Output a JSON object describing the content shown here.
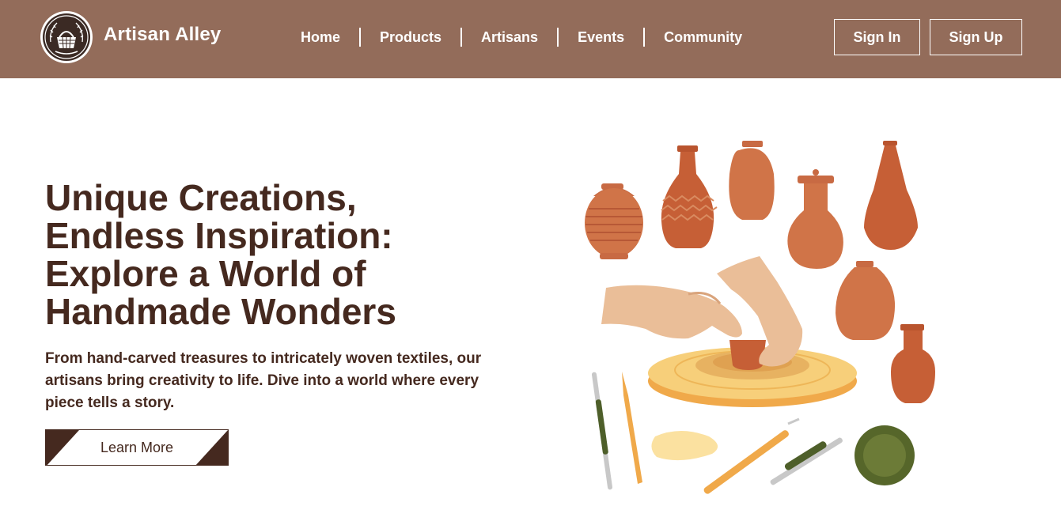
{
  "brand": {
    "name": "Artisan Alley",
    "logo_icon": "basket-emblem-icon"
  },
  "nav": {
    "items": [
      {
        "label": "Home"
      },
      {
        "label": "Products"
      },
      {
        "label": "Artisans"
      },
      {
        "label": "Events"
      },
      {
        "label": "Community"
      }
    ]
  },
  "auth": {
    "signin_label": "Sign In",
    "signup_label": "Sign Up"
  },
  "hero": {
    "title": "Unique Creations, Endless Inspiration: Explore a World of Handmade Wonders",
    "description": "From hand-carved treasures to intricately woven textiles, our artisans bring creativity to life. Dive into a world where every piece tells a story.",
    "cta_label": "Learn More",
    "illustration_icon": "pottery-wheel-illustration"
  },
  "colors": {
    "header_bg": "#936c5a",
    "text_dark": "#45291f",
    "terracotta": "#c65f36",
    "clay_light": "#d4774a",
    "wheel_yellow": "#f7cf7a",
    "olive": "#5c6b2e"
  }
}
